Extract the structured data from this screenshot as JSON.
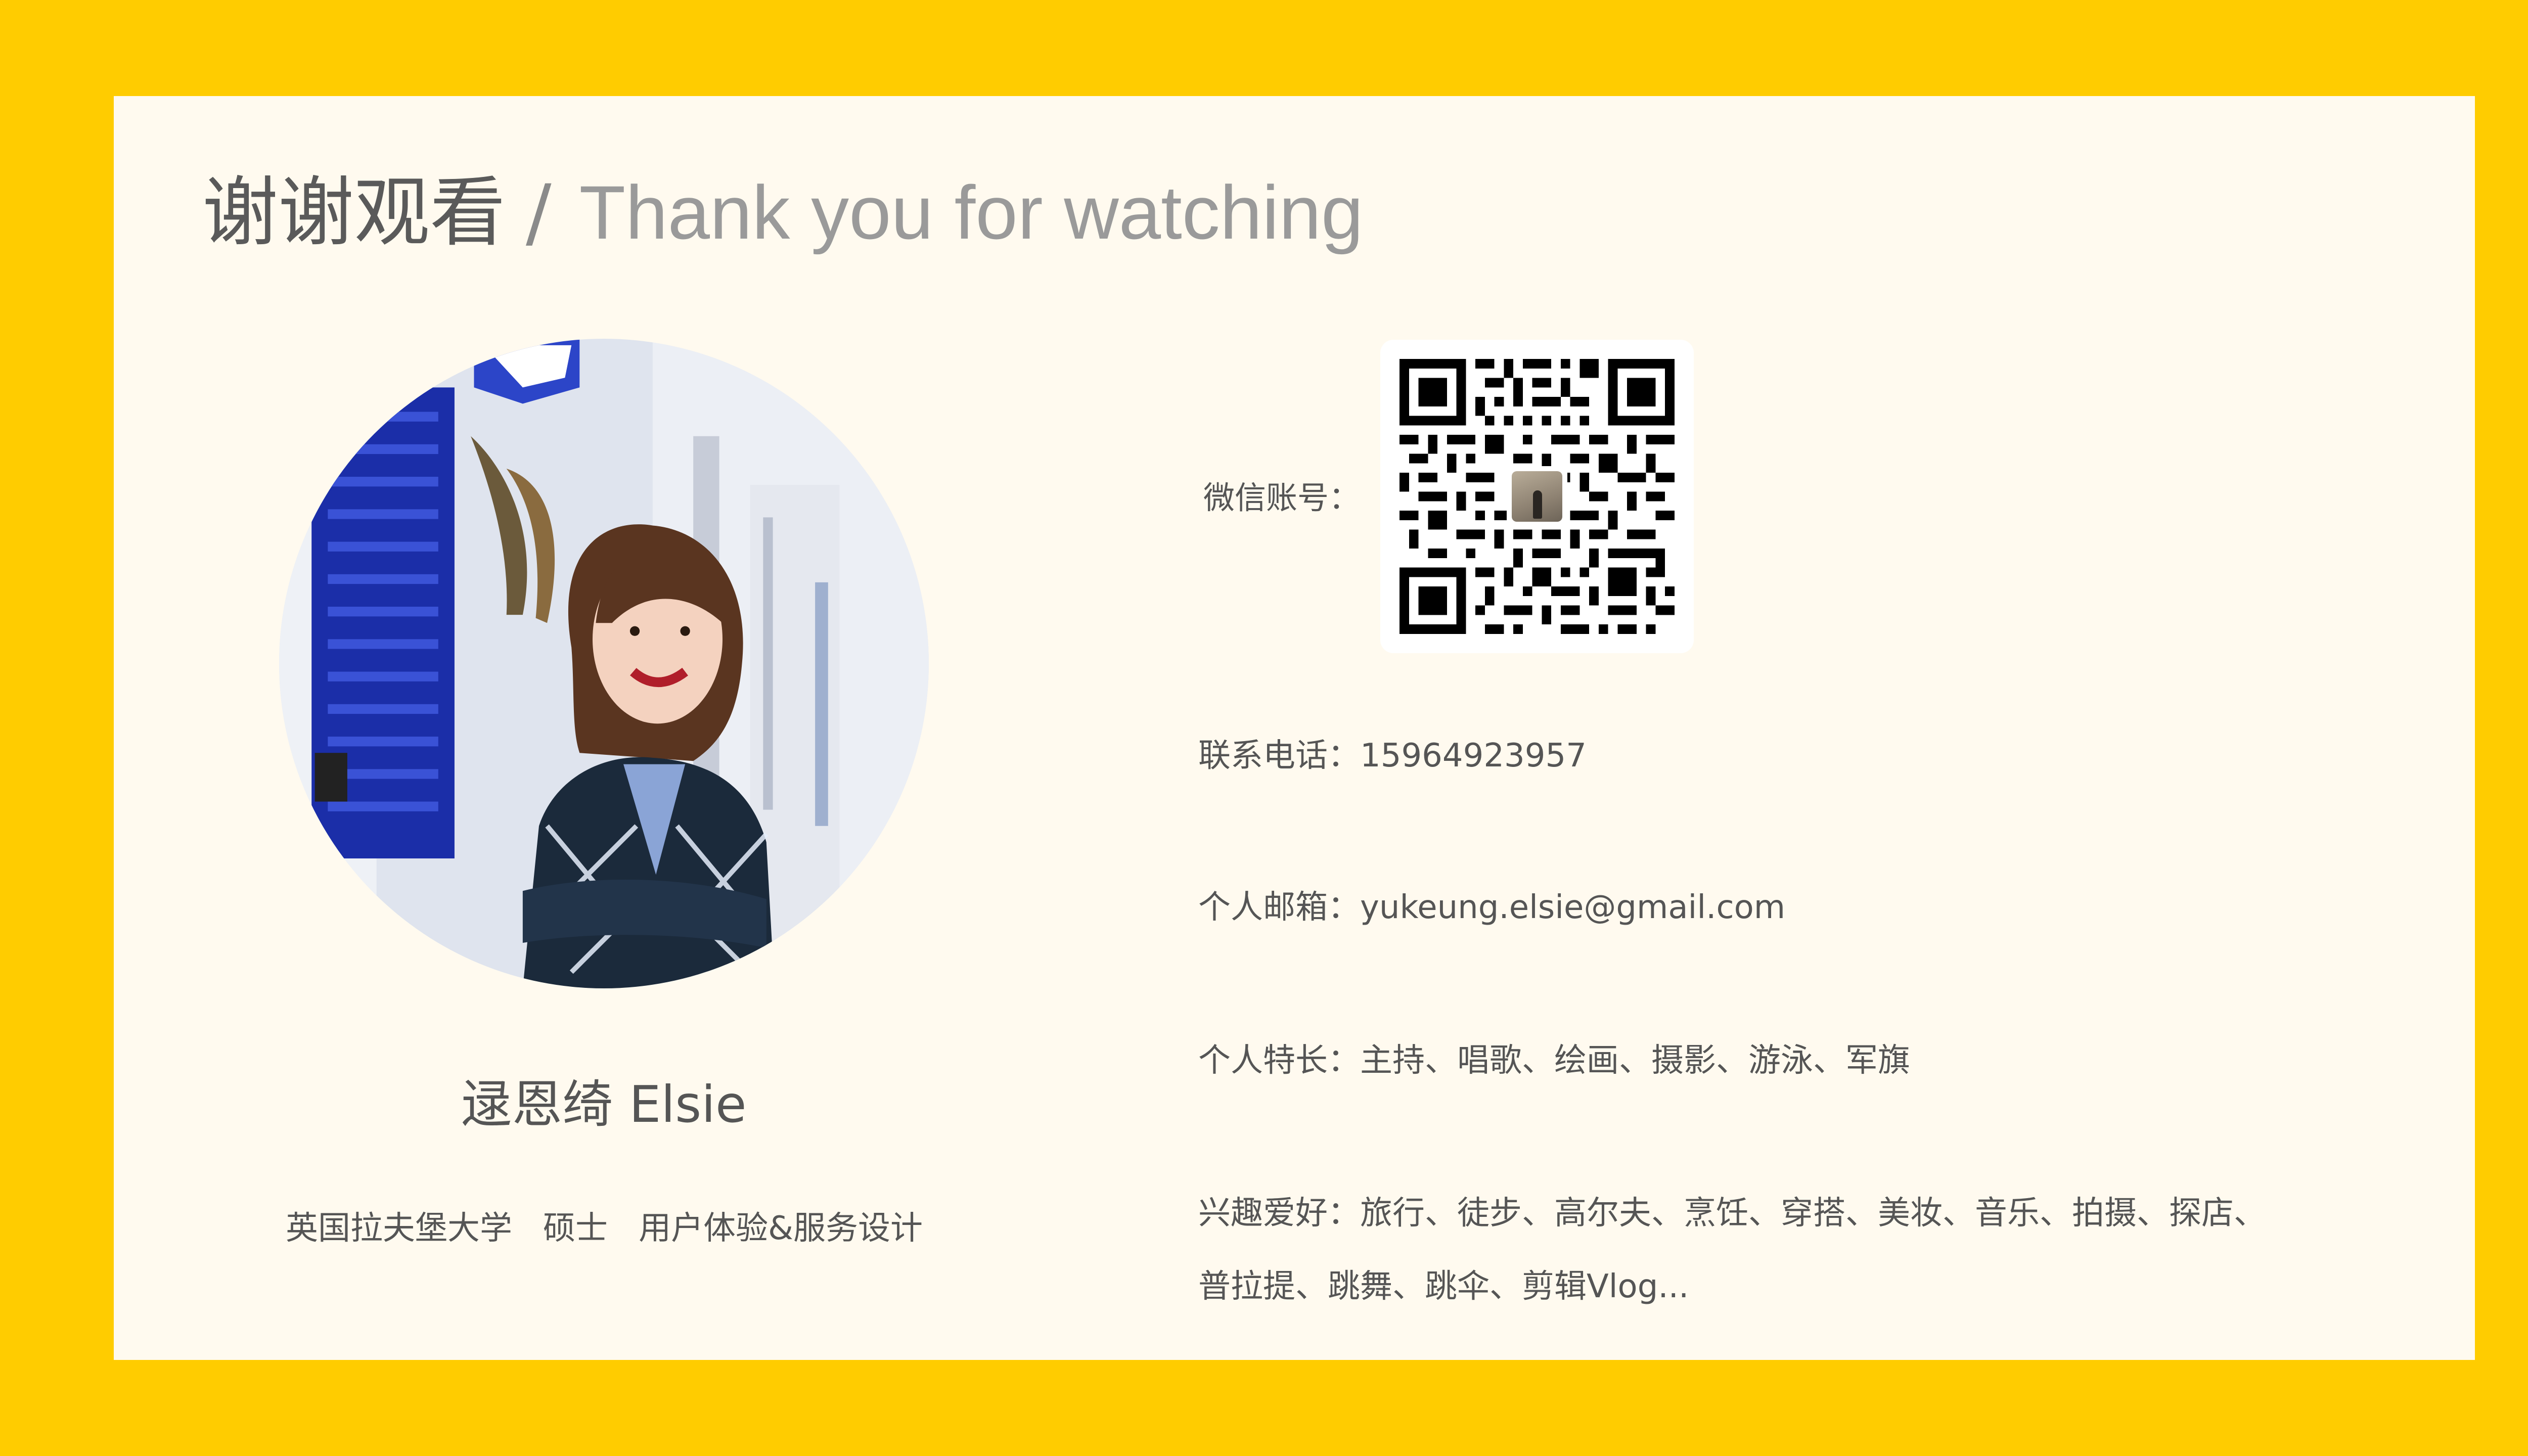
{
  "title": {
    "zh": "谢谢观看",
    "separator": "/",
    "en": "Thank you for watching"
  },
  "profile": {
    "name": "逯恩绮 Elsie",
    "education": "英国拉夫堡大学   硕士   用户体验&服务设计"
  },
  "contact": {
    "wechat_label": "微信账号：",
    "phone_label": "联系电话：",
    "phone_value": "15964923957",
    "email_label": "个人邮箱：",
    "email_value": "yukeung.elsie@gmail.com",
    "skills_label": "个人特长：",
    "skills_value": "主持、唱歌、绘画、摄影、游泳、军旗",
    "hobbies_label": "兴趣爱好：",
    "hobbies_value_line1": "旅行、徒步、高尔夫、烹饪、穿搭、美妆、音乐、拍摄、探店、",
    "hobbies_value_line2": "普拉提、跳舞、跳伞、剪辑Vlog..."
  },
  "colors": {
    "frame": "#FFCC00",
    "card": "#FFFAEF",
    "text": "#555555",
    "title_en": "#9A9A9A"
  },
  "icons": {
    "qr_code": "wechat-qr-code-icon",
    "photo": "profile-photo"
  }
}
